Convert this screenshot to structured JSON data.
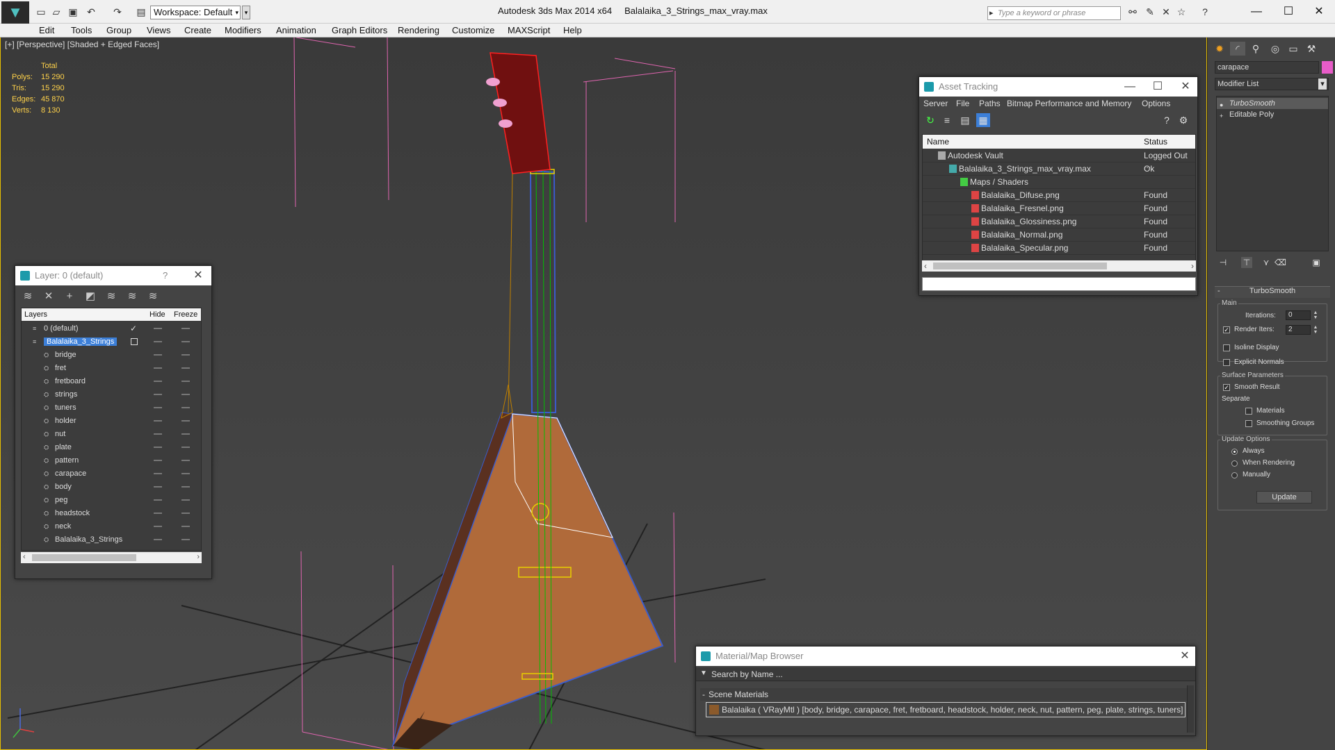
{
  "app": {
    "title": "Autodesk 3ds Max  2014 x64",
    "file": "Balalaika_3_Strings_max_vray.max",
    "workspace": "Workspace: Default",
    "search_placeholder": "Type a keyword or phrase"
  },
  "menus": [
    "Edit",
    "Tools",
    "Group",
    "Views",
    "Create",
    "Modifiers",
    "Animation",
    "Graph Editors",
    "Rendering",
    "Customize",
    "MAXScript",
    "Help"
  ],
  "viewport": {
    "label": "[+] [Perspective] [Shaded + Edged Faces]",
    "stats_header": "Total",
    "stats": [
      {
        "k": "Polys:",
        "v": "15 290"
      },
      {
        "k": "Tris:",
        "v": "15 290"
      },
      {
        "k": "Edges:",
        "v": "45 870"
      },
      {
        "k": "Verts:",
        "v": "8 130"
      }
    ]
  },
  "layer_dialog": {
    "title": "Layer: 0 (default)",
    "help": "?",
    "col_layers": "Layers",
    "col_hide": "Hide",
    "col_freeze": "Freeze",
    "rows": [
      {
        "name": "0 (default)",
        "type": "layer",
        "current": true
      },
      {
        "name": "Balalaika_3_Strings",
        "type": "layer",
        "selected": true
      },
      {
        "name": "bridge",
        "type": "object"
      },
      {
        "name": "fret",
        "type": "object"
      },
      {
        "name": "fretboard",
        "type": "object"
      },
      {
        "name": "strings",
        "type": "object"
      },
      {
        "name": "tuners",
        "type": "object"
      },
      {
        "name": "holder",
        "type": "object"
      },
      {
        "name": "nut",
        "type": "object"
      },
      {
        "name": "plate",
        "type": "object"
      },
      {
        "name": "pattern",
        "type": "object"
      },
      {
        "name": "carapace",
        "type": "object"
      },
      {
        "name": "body",
        "type": "object"
      },
      {
        "name": "peg",
        "type": "object"
      },
      {
        "name": "headstock",
        "type": "object"
      },
      {
        "name": "neck",
        "type": "object"
      },
      {
        "name": "Balalaika_3_Strings",
        "type": "object"
      }
    ]
  },
  "asset_dialog": {
    "title": "Asset Tracking",
    "menu": [
      "Server",
      "File",
      "Paths",
      "Bitmap Performance and Memory",
      "Options"
    ],
    "col_name": "Name",
    "col_status": "Status",
    "rows": [
      {
        "name": "Autodesk Vault",
        "status": "Logged Out ...",
        "level": 0,
        "icon": "vault-icon"
      },
      {
        "name": "Balalaika_3_Strings_max_vray.max",
        "status": "Ok",
        "level": 1,
        "icon": "max-file-icon"
      },
      {
        "name": "Maps / Shaders",
        "status": "",
        "level": 2,
        "icon": "maps-folder-icon"
      },
      {
        "name": "Balalaika_Difuse.png",
        "status": "Found",
        "level": 3,
        "icon": "png-icon"
      },
      {
        "name": "Balalaika_Fresnel.png",
        "status": "Found",
        "level": 3,
        "icon": "png-icon"
      },
      {
        "name": "Balalaika_Glossiness.png",
        "status": "Found",
        "level": 3,
        "icon": "png-icon"
      },
      {
        "name": "Balalaika_Normal.png",
        "status": "Found",
        "level": 3,
        "icon": "png-icon"
      },
      {
        "name": "Balalaika_Specular.png",
        "status": "Found",
        "level": 3,
        "icon": "png-icon"
      }
    ]
  },
  "material_dialog": {
    "title": "Material/Map Browser",
    "search": "Search by Name ...",
    "section": "Scene Materials",
    "item": "Balalaika  ( VRayMtl )  [body, bridge, carapace, fret, fretboard, headstock, holder, neck, nut, pattern, peg, plate, strings, tuners]"
  },
  "command_panel": {
    "object_name": "carapace",
    "modifier_list": "Modifier List",
    "stack": [
      {
        "name": "TurboSmooth",
        "active": true
      },
      {
        "name": "Editable Poly",
        "active": false
      }
    ],
    "rollout_title": "TurboSmooth",
    "main_label": "Main",
    "iterations_label": "Iterations:",
    "iterations_value": "0",
    "render_iters_label": "Render Iters:",
    "render_iters_value": "2",
    "isoline_label": "Isoline Display",
    "explicit_label": "Explicit Normals",
    "surface_label": "Surface Parameters",
    "smooth_label": "Smooth Result",
    "separate_label": "Separate",
    "materials_label": "Materials",
    "smoothing_groups_label": "Smoothing Groups",
    "update_options_label": "Update Options",
    "always_label": "Always",
    "when_rendering_label": "When Rendering",
    "manually_label": "Manually",
    "update_button": "Update"
  },
  "colors": {
    "selection_blue": "#3c7fd8",
    "stats_yellow": "#ffd24a",
    "object_color": "#e85cc8"
  }
}
